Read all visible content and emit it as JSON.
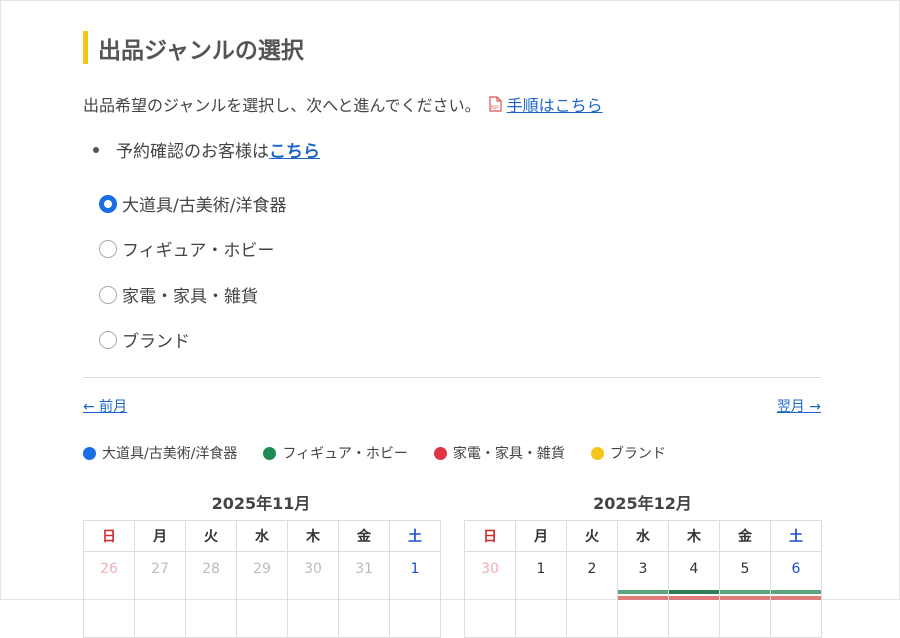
{
  "page": {
    "title": "出品ジャンルの選択",
    "description": "出品希望のジャンルを選択し、次へと進んでください。",
    "procedure_link": "手順はこちら",
    "reservation_text": "予約確認のお客様は",
    "reservation_link": "こちら"
  },
  "genres": [
    {
      "label": "大道具/古美術/洋食器",
      "checked": true
    },
    {
      "label": "フィギュア・ホビー",
      "checked": false
    },
    {
      "label": "家電・家具・雑貨",
      "checked": false
    },
    {
      "label": "ブランド",
      "checked": false
    }
  ],
  "nav": {
    "prev": "← 前月",
    "next": "翌月 →"
  },
  "legend": [
    {
      "label": "大道具/古美術/洋食器",
      "color": "#1a6ee6"
    },
    {
      "label": "フィギュア・ホビー",
      "color": "#1e8a55"
    },
    {
      "label": "家電・家具・雑貨",
      "color": "#dc3545"
    },
    {
      "label": "ブランド",
      "color": "#f5c518"
    }
  ],
  "weekdays": [
    "日",
    "月",
    "火",
    "水",
    "木",
    "金",
    "土"
  ],
  "calendars": [
    {
      "title": "2025年11月",
      "days": [
        "26",
        "27",
        "28",
        "29",
        "30",
        "31",
        "1"
      ]
    },
    {
      "title": "2025年12月",
      "days": [
        "30",
        "1",
        "2",
        "3",
        "4",
        "5",
        "6"
      ]
    }
  ],
  "colors": {
    "accent": "#f5c518",
    "link": "#1a66c9",
    "radio": "#1a6ee6"
  }
}
